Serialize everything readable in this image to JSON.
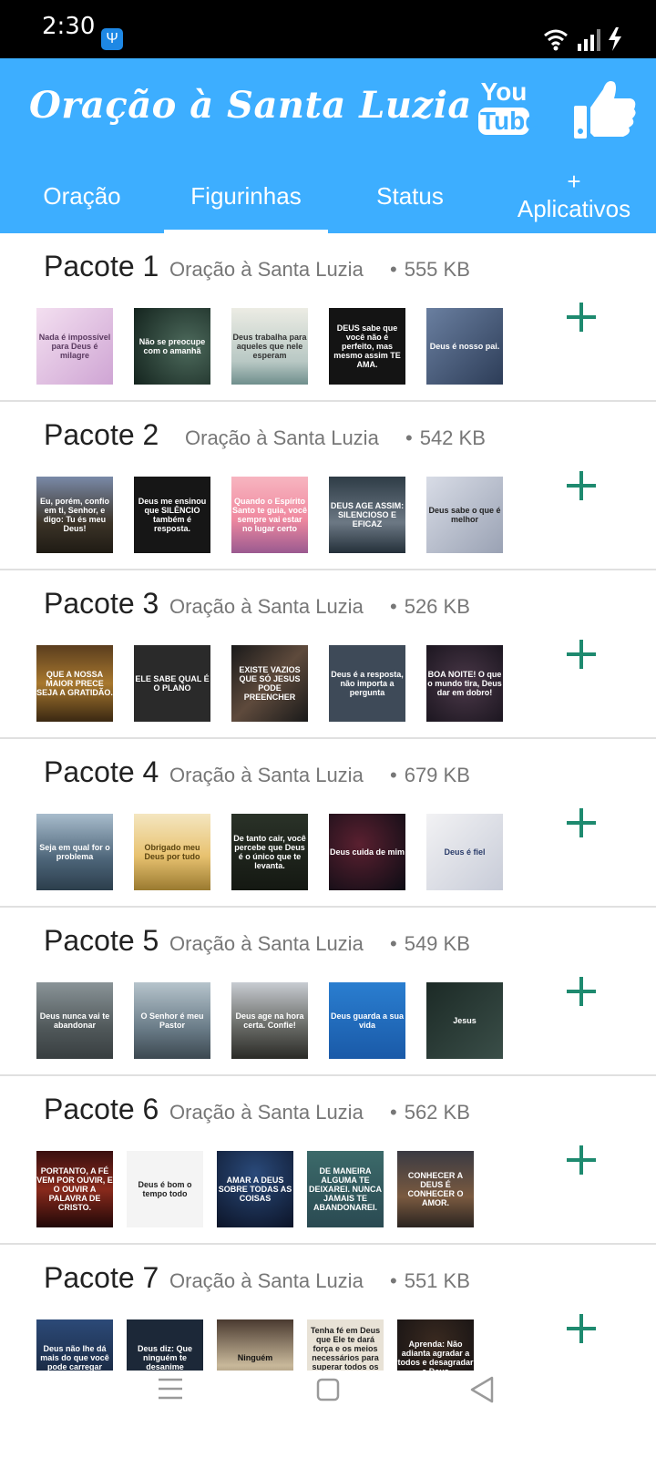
{
  "status_bar": {
    "time": "2:30"
  },
  "app": {
    "title": "Oração à Santa Luzia",
    "youtube_top": "You",
    "youtube_bottom": "Tube",
    "colors": {
      "appbar": "#3daeff",
      "add": "#1e8a6f"
    }
  },
  "tabs": [
    {
      "label": "Oração"
    },
    {
      "label": "Figurinhas",
      "active": true
    },
    {
      "label": "Status"
    },
    {
      "label_top": "+",
      "label_bottom": "Aplicativos"
    }
  ],
  "packs": [
    {
      "name": "Pacote 1",
      "publisher": "Oração à Santa Luzia",
      "size": "555 KB",
      "stickers": [
        "Nada é impossível para Deus é milagre",
        "Não se preocupe com o amanhã",
        "Deus trabalha para aqueles que nele esperam",
        "DEUS sabe que você não é perfeito, mas mesmo assim TE AMA.",
        "Deus é nosso pai."
      ]
    },
    {
      "name": "Pacote 2",
      "publisher": "Oração à Santa Luzia",
      "size": "542 KB",
      "stickers": [
        "Eu, porém, confio em ti, Senhor, e digo: Tu és meu Deus!",
        "Deus me ensinou que SILÊNCIO também é resposta.",
        "Quando o Espírito Santo te guia, você sempre vai estar no lugar certo",
        "DEUS AGE ASSIM: SILENCIOSO E EFICAZ",
        "Deus sabe o que é melhor"
      ]
    },
    {
      "name": "Pacote 3",
      "publisher": "Oração à Santa Luzia",
      "size": "526 KB",
      "stickers": [
        "QUE A NOSSA MAIOR PRECE SEJA A GRATIDÃO.",
        "ELE SABE QUAL É O PLANO",
        "EXISTE VAZIOS QUE SÓ JESUS PODE PREENCHER",
        "Deus é a resposta, não importa a pergunta",
        "BOA NOITE! O que o mundo tira, Deus dar em dobro!"
      ]
    },
    {
      "name": "Pacote 4",
      "publisher": "Oração à Santa Luzia",
      "size": "679 KB",
      "stickers": [
        "Seja em qual for o problema",
        "Obrigado meu Deus por tudo",
        "De tanto cair, você percebe que Deus é o único que te levanta.",
        "Deus cuida de mim",
        "Deus é fiel"
      ]
    },
    {
      "name": "Pacote 5",
      "publisher": "Oração à Santa Luzia",
      "size": "549 KB",
      "stickers": [
        "Deus nunca vai te abandonar",
        "O Senhor é meu Pastor",
        "Deus age na hora certa. Confie!",
        "Deus guarda a sua vida",
        "Jesus"
      ]
    },
    {
      "name": "Pacote 6",
      "publisher": "Oração à Santa Luzia",
      "size": "562 KB",
      "stickers": [
        "PORTANTO, A FÉ VEM POR OUVIR, E O OUVIR A PALAVRA DE CRISTO.",
        "Deus é bom o tempo todo",
        "AMAR A DEUS SOBRE TODAS AS COISAS",
        "DE MANEIRA ALGUMA TE DEIXAREI. NUNCA JAMAIS TE ABANDONAREI.",
        "CONHECER A DEUS É CONHECER O AMOR."
      ]
    },
    {
      "name": "Pacote 7",
      "publisher": "Oração à Santa Luzia",
      "size": "551 KB",
      "stickers": [
        "Deus não lhe dá mais do que você pode carregar",
        "Deus diz: Que ninguém te desanime",
        "Ninguém",
        "Tenha fé em Deus que Ele te dará força e os meios necessários para superar todos os obstáculos da vida!",
        "Aprenda: Não adianta agradar a todos e desagradar a Deus"
      ]
    }
  ]
}
